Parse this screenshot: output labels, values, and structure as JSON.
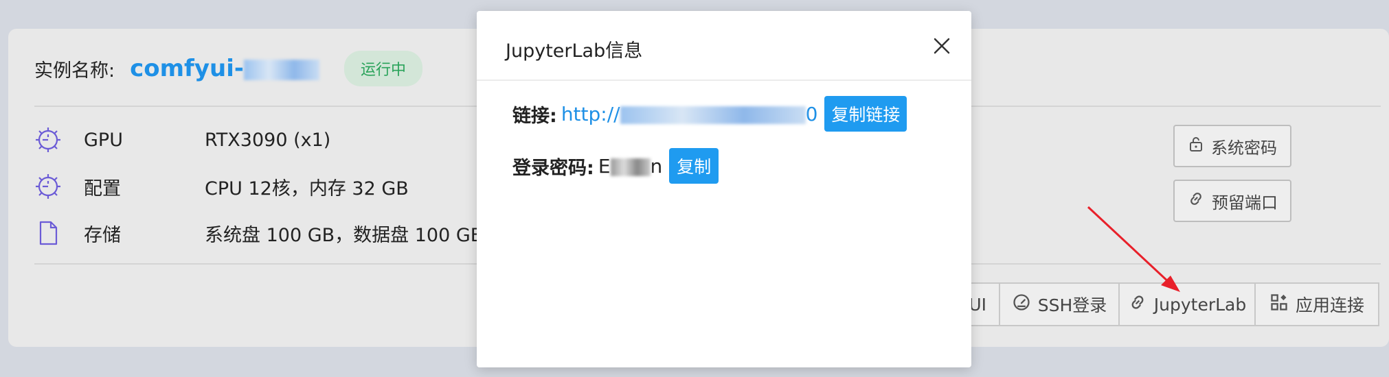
{
  "instance": {
    "label": "实例名称:",
    "name": "comfyui-",
    "status": "运行中"
  },
  "specs": [
    {
      "icon": "gpu-icon",
      "key": "GPU",
      "value": "RTX3090 (x1)"
    },
    {
      "icon": "config-icon",
      "key": "配置",
      "value": "CPU 12核，内存 32 GB"
    },
    {
      "icon": "file-icon",
      "key": "存储",
      "value": "系统盘 100 GB，数据盘 100 GB"
    }
  ],
  "side_buttons": {
    "system_password": "系统密码",
    "reserved_port": "预留端口"
  },
  "toolbar": {
    "ui_partial": "UI",
    "ssh_login": "SSH登录",
    "jupyterlab": "JupyterLab",
    "app_connect": "应用连接"
  },
  "modal": {
    "title": "JupyterLab信息",
    "link_label": "链接:",
    "link_prefix": "http://",
    "link_suffix": "0",
    "copy_link": "复制链接",
    "password_label": "登录密码:",
    "password_start": "E",
    "password_end": "n",
    "copy": "复制"
  },
  "colors": {
    "accent": "#1e90e6",
    "button": "#1f9bf0",
    "status_text": "#2aa35a",
    "status_bg": "#d3e6d8",
    "arrow": "#e8202a"
  }
}
